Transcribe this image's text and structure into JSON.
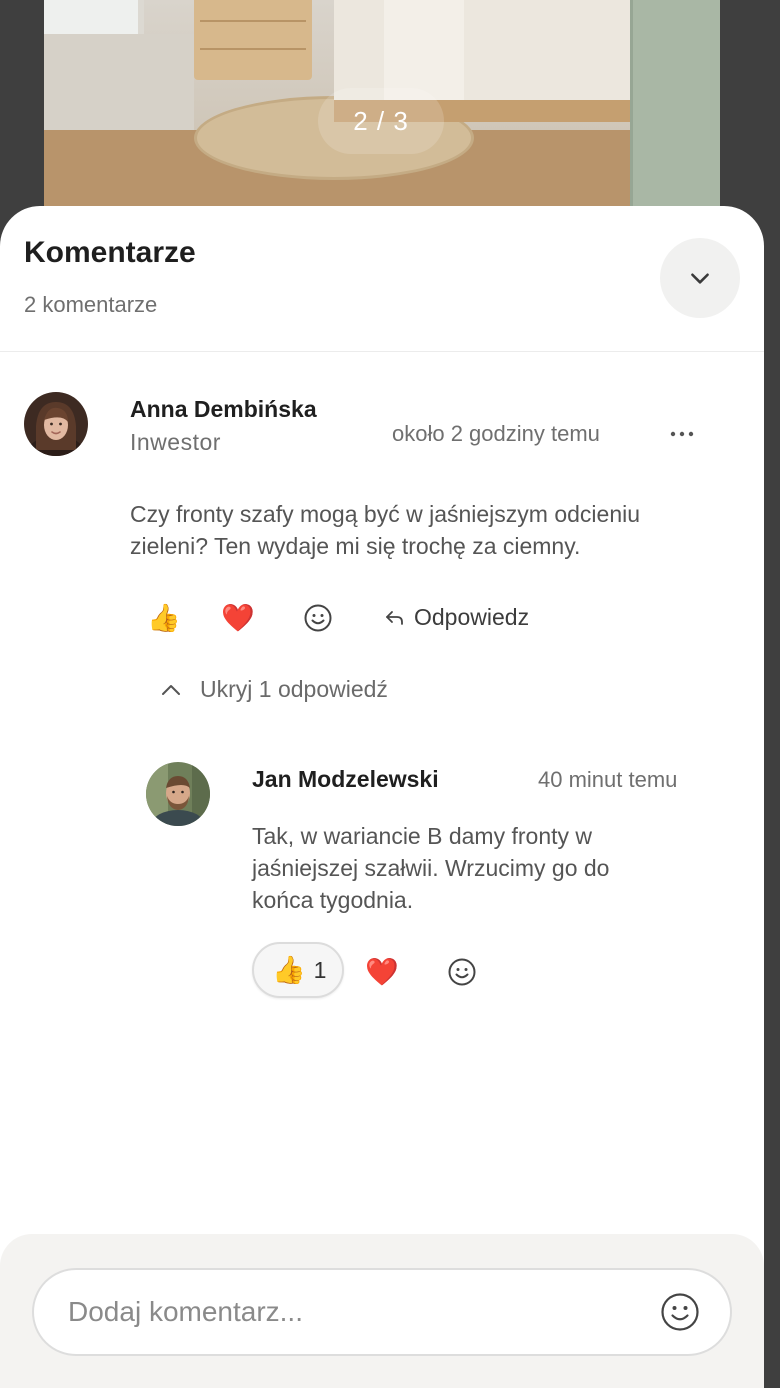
{
  "viewer": {
    "counter": "2 / 3"
  },
  "sheet": {
    "title": "Komentarze",
    "subtitle": "2 komentarze"
  },
  "comments": [
    {
      "author": "Anna Dembińska",
      "role": "Inwestor",
      "time": "około 2 godziny temu",
      "text_line1": "Czy fronty szafy mogą być w jaśniejszym odcieniu",
      "text_line2": "zieleni? Ten wydaje mi się trochę za ciemny.",
      "reactions": {
        "thumbs": "👍",
        "heart": "❤️"
      },
      "reply_label": "Odpowiedz",
      "toggle_replies_label": "Ukryj 1 odpowiedź",
      "replies": [
        {
          "author": "Jan Modzelewski",
          "time": "40 minut temu",
          "text_line1": "Tak, w wariancie B damy fronty w",
          "text_line2": "jaśniejszej szałwii. Wrzucimy go do",
          "text_line3": "końca tygodnia.",
          "reaction_thumbs": "👍",
          "reaction_thumbs_count": "1",
          "reaction_heart": "❤️"
        }
      ]
    }
  ],
  "composer": {
    "placeholder": "Dodaj komentarz..."
  },
  "icons": {
    "collapse": "chevron-down-icon",
    "more": "more-horizontal-icon",
    "emoji": "smiley-icon",
    "reply": "reply-arrow-icon",
    "toggle": "chevron-up-icon"
  },
  "colors": {
    "backdrop": "#3f3f3f",
    "sheet": "#ffffff",
    "muted_text": "#6f6f6f",
    "composer_bg": "#f4f3f1"
  }
}
